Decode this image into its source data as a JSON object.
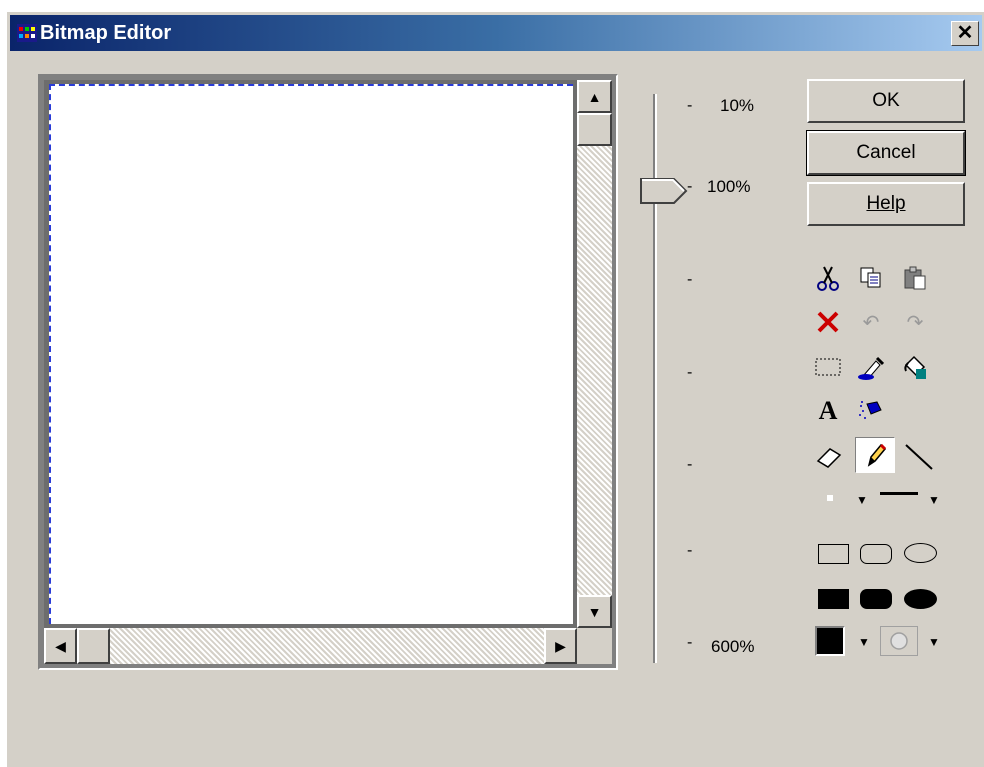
{
  "window": {
    "title": "Bitmap Editor",
    "close_label": "✕"
  },
  "buttons": {
    "ok": "OK",
    "cancel": "Cancel",
    "help": "Help"
  },
  "zoom": {
    "labels": [
      "10%",
      "100%",
      "600%"
    ],
    "current": "100%"
  },
  "tools": [
    {
      "name": "cut-icon",
      "glyph": "✂"
    },
    {
      "name": "copy-icon",
      "glyph": "⎘"
    },
    {
      "name": "paste-icon",
      "glyph": "📋"
    },
    {
      "name": "delete-icon",
      "glyph": "✕"
    },
    {
      "name": "undo-icon",
      "glyph": "↶"
    },
    {
      "name": "redo-icon",
      "glyph": "↷"
    },
    {
      "name": "select-rect-icon",
      "glyph": "⬚"
    },
    {
      "name": "color-picker-icon",
      "glyph": "✎"
    },
    {
      "name": "fill-icon",
      "glyph": "◈"
    },
    {
      "name": "text-icon",
      "glyph": "A"
    },
    {
      "name": "airbrush-icon",
      "glyph": "☄"
    },
    {
      "name": "eraser-icon",
      "glyph": "◇"
    },
    {
      "name": "pencil-icon",
      "glyph": "✏"
    },
    {
      "name": "line-icon",
      "glyph": "╲"
    }
  ],
  "colors": {
    "title_start": "#0a246a",
    "title_end": "#a6caf0",
    "face": "#d4d0c8",
    "selection_dash": "#2a3cd8",
    "delete_red": "#cc0000"
  }
}
